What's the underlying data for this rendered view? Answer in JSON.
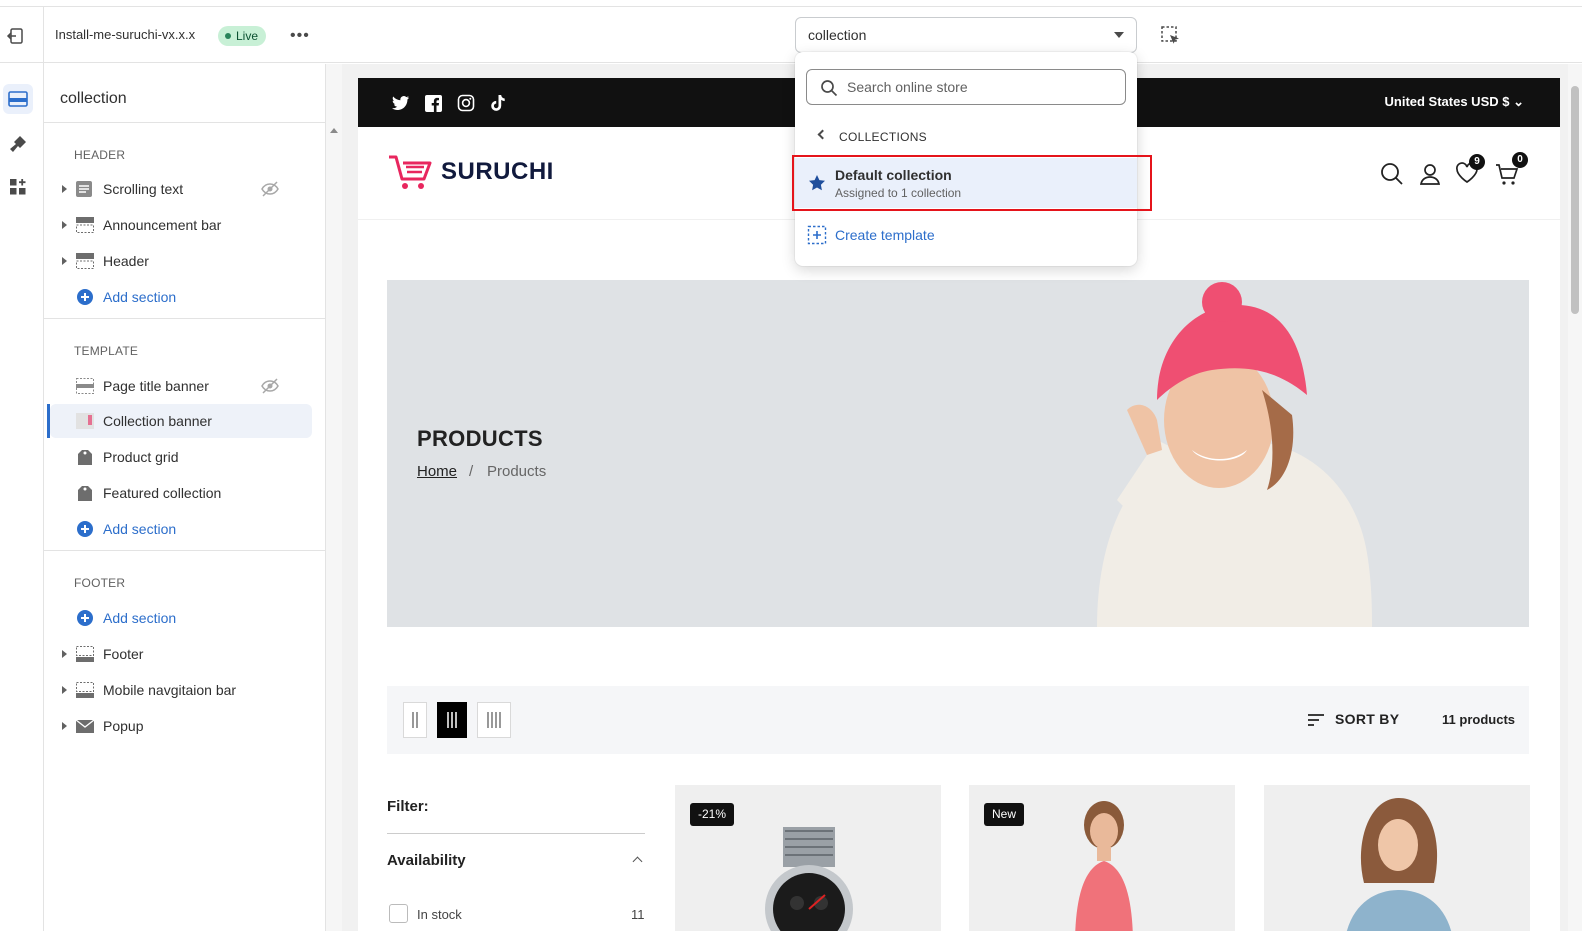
{
  "topbar": {
    "theme_name": "Install-me-suruchi-vx.x.x",
    "live_badge": "Live",
    "more_label": "•••",
    "template_select_value": "collection"
  },
  "sidebar": {
    "title": "collection",
    "groups": [
      {
        "label": "HEADER",
        "items": [
          {
            "label": "Scrolling text",
            "icon": "text-block-icon",
            "hidden": true
          },
          {
            "label": "Announcement bar",
            "icon": "section-icon"
          },
          {
            "label": "Header",
            "icon": "section-icon"
          },
          {
            "label": "Add section",
            "icon": "add-circle-icon"
          }
        ]
      },
      {
        "label": "TEMPLATE",
        "items": [
          {
            "label": "Page title banner",
            "icon": "section-icon",
            "hidden": true
          },
          {
            "label": "Collection banner",
            "icon": "image-icon",
            "selected": true
          },
          {
            "label": "Product grid",
            "icon": "tag-icon"
          },
          {
            "label": "Featured collection",
            "icon": "tag-icon"
          },
          {
            "label": "Add section",
            "icon": "add-circle-icon"
          }
        ]
      },
      {
        "label": "FOOTER",
        "items": [
          {
            "label": "Add section",
            "icon": "add-circle-icon"
          },
          {
            "label": "Footer",
            "icon": "section-icon"
          },
          {
            "label": "Mobile navgitaion bar",
            "icon": "section-icon"
          },
          {
            "label": "Popup",
            "icon": "envelope-icon"
          }
        ]
      }
    ]
  },
  "dropdown": {
    "search_placeholder": "Search online store",
    "back_label": "COLLECTIONS",
    "item_title": "Default collection",
    "item_subtitle": "Assigned to 1 collection",
    "create_label": "Create template"
  },
  "store": {
    "currency": "United States USD $",
    "logo": "SURUCHI",
    "wishlist_count": "9",
    "cart_count": "0",
    "banner_title": "PRODUCTS",
    "breadcrumb_home": "Home",
    "breadcrumb_sep": "/",
    "breadcrumb_current": "Products",
    "sort_label": "SORT BY",
    "product_count": "11 products",
    "filter_label": "Filter:",
    "availability_label": "Availability",
    "in_stock_label": "In stock",
    "in_stock_count": "11",
    "cards": [
      {
        "badge": "-21%"
      },
      {
        "badge": "New"
      },
      {
        "badge": ""
      }
    ]
  },
  "colors": {
    "accent": "#2c6ecb",
    "highlight": "#e5141b",
    "brand_pink": "#e8265e",
    "live_green": "#29845a"
  }
}
